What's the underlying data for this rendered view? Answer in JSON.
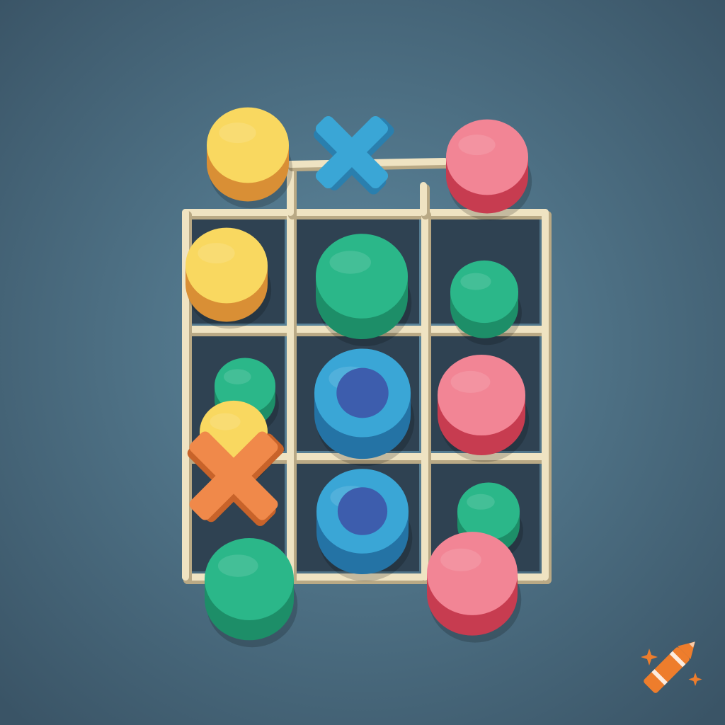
{
  "game": {
    "type": "tic-tac-toe",
    "grid": {
      "rows": 3,
      "cols": 3
    }
  },
  "colors": {
    "background_center": "#5f8aa0",
    "background_edge": "#3a5466",
    "cell": "#2f4252",
    "grid_line": "#efe3c2",
    "grid_line_shade": "#b9a985",
    "yellow_top": "#f9d860",
    "yellow_side": "#d98f35",
    "green_top": "#2bb789",
    "green_side": "#1d8e68",
    "pink_top": "#f28595",
    "pink_side": "#c73c50",
    "blue_top": "#3aa6d6",
    "blue_side": "#2473a5",
    "blue_inner": "#3d5dad",
    "blue_x": "#3aa6d6",
    "blue_x_shade": "#2a7fae",
    "orange_x": "#f0894a",
    "orange_x_shade": "#c8632a",
    "watermark_orange": "#ee7d2c"
  },
  "pieces": [
    {
      "kind": "disc",
      "color": "yellow",
      "where": "above-left"
    },
    {
      "kind": "x",
      "color": "blue",
      "where": "above-middle"
    },
    {
      "kind": "disc",
      "color": "pink",
      "where": "above-right"
    },
    {
      "kind": "disc",
      "color": "yellow",
      "cell": [
        0,
        0
      ]
    },
    {
      "kind": "disc",
      "color": "green",
      "cell": [
        0,
        1
      ]
    },
    {
      "kind": "disc",
      "color": "green",
      "cell": [
        0,
        2
      ]
    },
    {
      "kind": "disc",
      "color": "green",
      "cell": [
        1,
        0
      ]
    },
    {
      "kind": "ring",
      "color": "blue",
      "cell": [
        1,
        1
      ]
    },
    {
      "kind": "disc",
      "color": "pink",
      "cell": [
        1,
        2
      ]
    },
    {
      "kind": "disc",
      "color": "yellow",
      "cell": [
        2,
        0
      ]
    },
    {
      "kind": "x",
      "color": "orange",
      "cell": [
        2,
        0
      ]
    },
    {
      "kind": "ring",
      "color": "blue",
      "cell": [
        2,
        1
      ]
    },
    {
      "kind": "disc",
      "color": "green",
      "cell": [
        2,
        2
      ]
    },
    {
      "kind": "disc",
      "color": "green",
      "where": "below-left"
    },
    {
      "kind": "disc",
      "color": "pink",
      "where": "below-right"
    }
  ],
  "watermark": {
    "icon": "crayon-icon"
  }
}
